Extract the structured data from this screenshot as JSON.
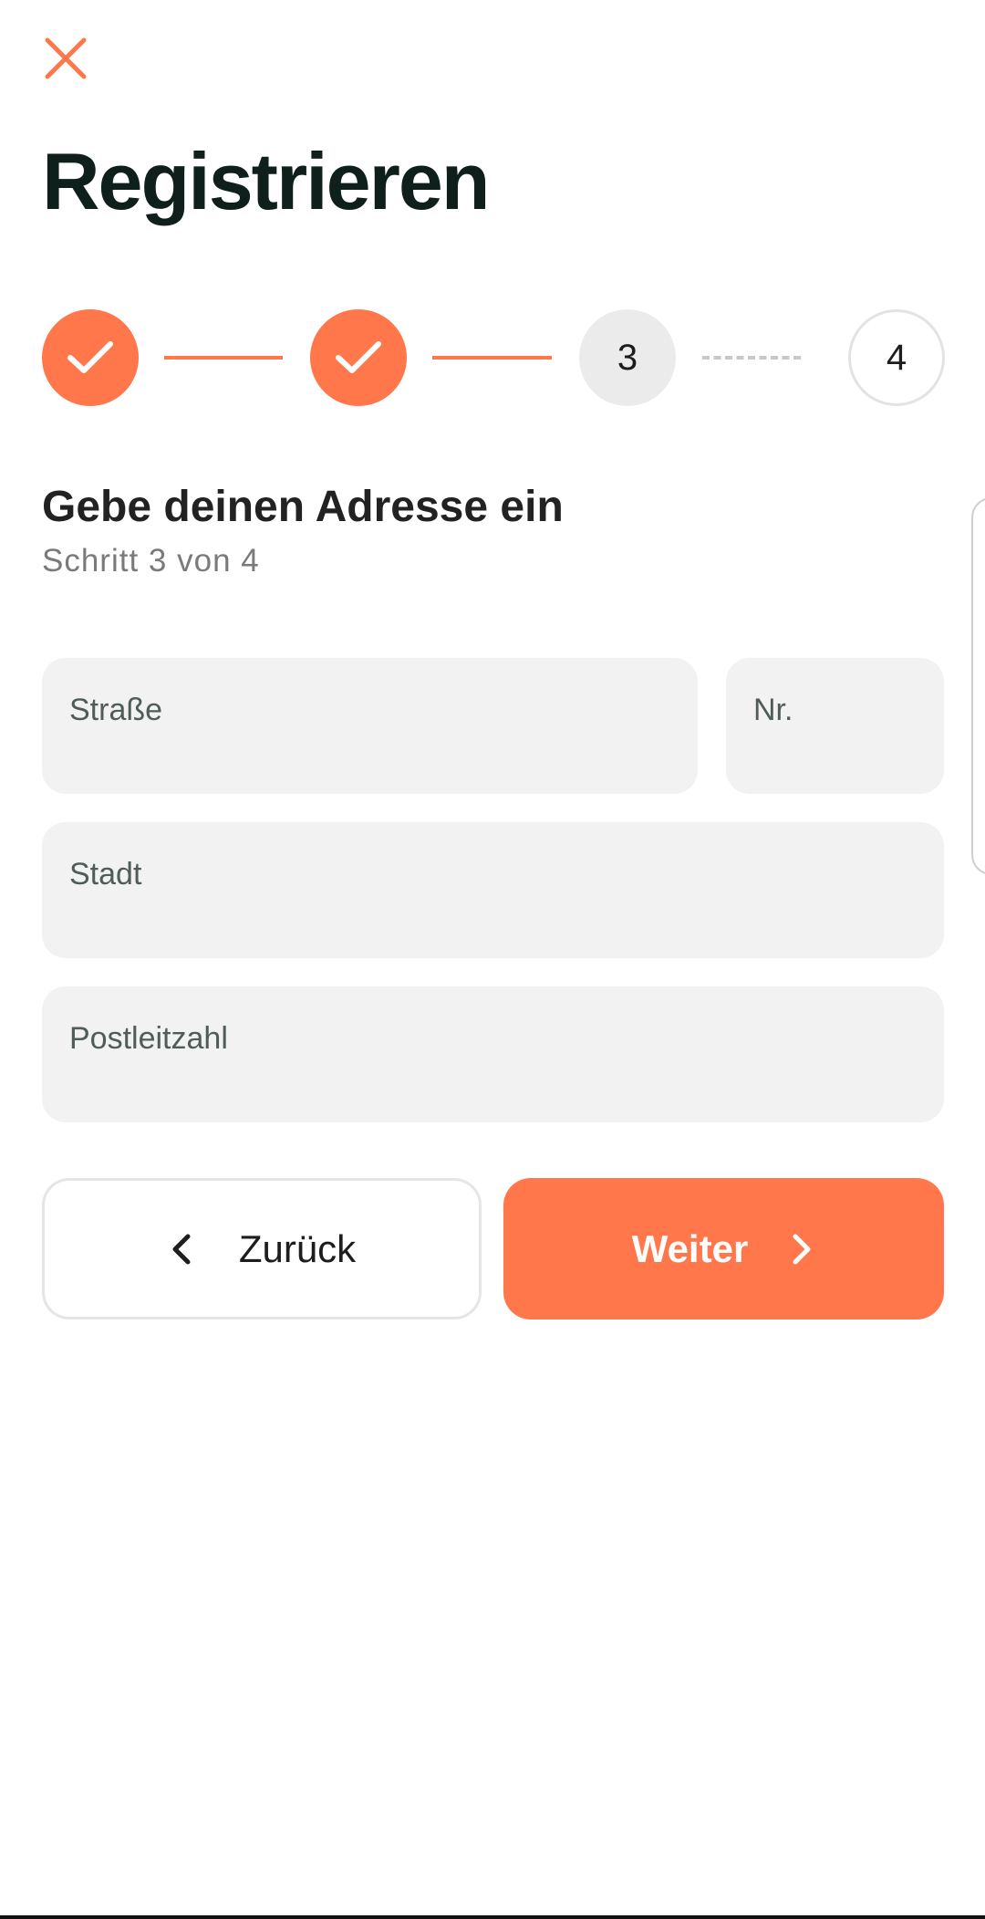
{
  "header": {
    "close_icon": "close-icon",
    "title": "Registrieren"
  },
  "stepper": {
    "steps": [
      {
        "label": "",
        "state": "done",
        "icon": "check-icon"
      },
      {
        "label": "",
        "state": "done",
        "icon": "check-icon"
      },
      {
        "label": "3",
        "state": "current"
      },
      {
        "label": "4",
        "state": "upcoming"
      }
    ],
    "connectors": [
      "solid",
      "solid",
      "dashed"
    ]
  },
  "section": {
    "heading": "Gebe deinen Adresse ein",
    "subtitle": "Schritt 3 von 4"
  },
  "form": {
    "street_label": "Straße",
    "number_label": "Nr.",
    "city_label": "Stadt",
    "zip_label": "Postleitzahl"
  },
  "actions": {
    "back_label": "Zurück",
    "next_label": "Weiter"
  },
  "colors": {
    "accent": "#ff774a",
    "field_bg": "#f2f2f2",
    "title": "#0f1f1c"
  }
}
